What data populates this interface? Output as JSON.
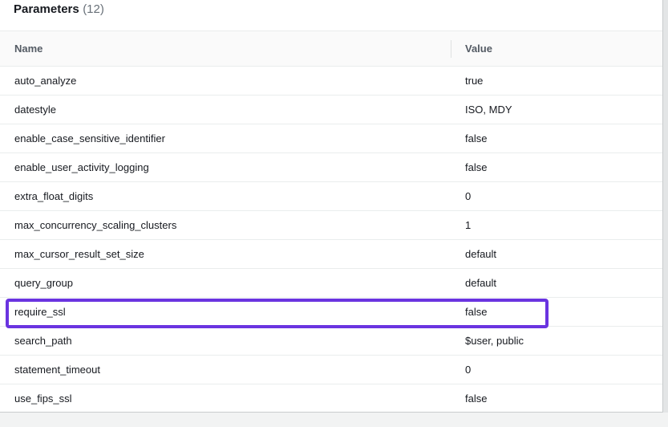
{
  "panel": {
    "title": "Parameters",
    "count": "(12)"
  },
  "table": {
    "columns": {
      "name": "Name",
      "value": "Value"
    },
    "rows": [
      {
        "name": "auto_analyze",
        "value": "true"
      },
      {
        "name": "datestyle",
        "value": "ISO, MDY"
      },
      {
        "name": "enable_case_sensitive_identifier",
        "value": "false"
      },
      {
        "name": "enable_user_activity_logging",
        "value": "false"
      },
      {
        "name": "extra_float_digits",
        "value": "0"
      },
      {
        "name": "max_concurrency_scaling_clusters",
        "value": "1"
      },
      {
        "name": "max_cursor_result_set_size",
        "value": "default"
      },
      {
        "name": "query_group",
        "value": "default"
      },
      {
        "name": "require_ssl",
        "value": "false"
      },
      {
        "name": "search_path",
        "value": "$user, public"
      },
      {
        "name": "statement_timeout",
        "value": "0"
      },
      {
        "name": "use_fips_ssl",
        "value": "false"
      }
    ]
  },
  "highlight": {
    "row": "require_ssl",
    "color": "#6a34e0"
  }
}
